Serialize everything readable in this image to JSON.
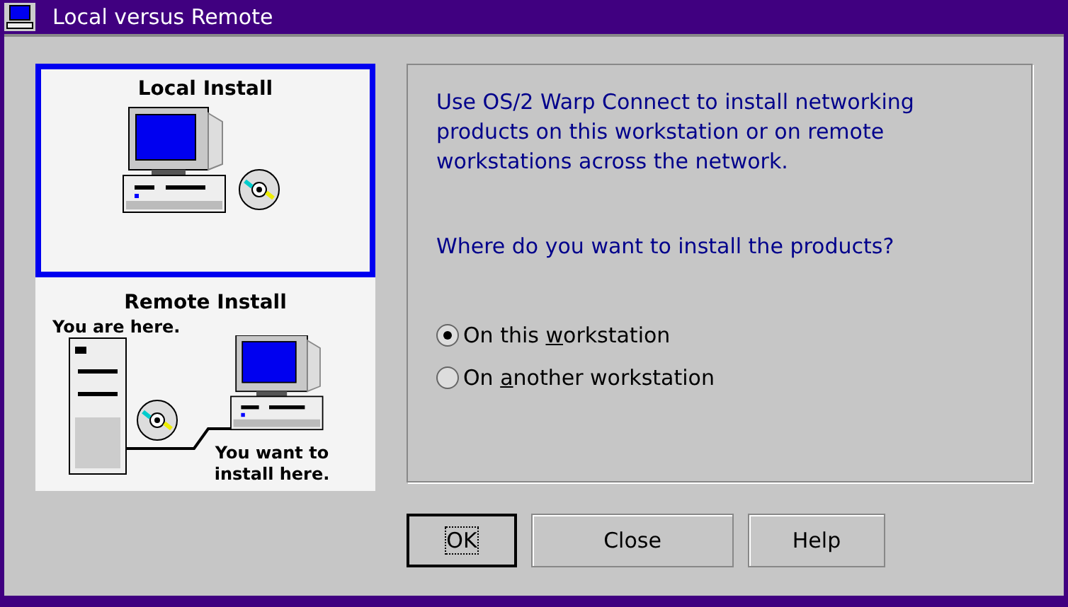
{
  "window": {
    "title": "Local versus Remote"
  },
  "install_options": [
    {
      "kind": "local",
      "title": "Local Install",
      "selected": true
    },
    {
      "kind": "remote",
      "title": "Remote Install",
      "selected": false,
      "here_label": "You are here.",
      "target_label": "You want to install here."
    }
  ],
  "description": "Use OS/2 Warp Connect to install networking products on this workstation or on remote workstations across the network.",
  "question": "Where do you want to install the products?",
  "radios": [
    {
      "before": "On this ",
      "mnemonic": "w",
      "after": "orkstation",
      "selected": true
    },
    {
      "before": "On ",
      "mnemonic": "a",
      "after": "nother workstation",
      "selected": false
    }
  ],
  "buttons": [
    {
      "label": "OK",
      "default": true
    },
    {
      "label": "Close",
      "default": false
    },
    {
      "label": "Help",
      "default": false
    }
  ]
}
